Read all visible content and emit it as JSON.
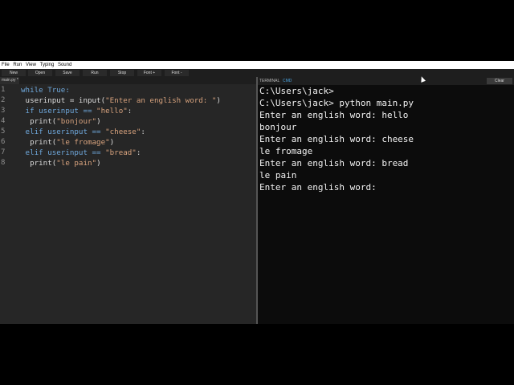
{
  "menu": {
    "items": [
      "File",
      "Run",
      "View",
      "Typing",
      "Sound"
    ]
  },
  "toolbar": {
    "buttons": [
      "New",
      "Open",
      "Save",
      "Run",
      "Stop",
      "Font +",
      "Font -"
    ]
  },
  "editor": {
    "tab_label": "main.py *",
    "line_numbers": [
      "1",
      "2",
      "3",
      "4",
      "5",
      "6",
      "7",
      "8"
    ],
    "lines": [
      [
        {
          "t": "while True:",
          "k": "kw"
        }
      ],
      [
        {
          "t": " userinput = input(",
          "k": ""
        },
        {
          "t": "\"Enter an english word: \"",
          "k": "str"
        },
        {
          "t": ")",
          "k": ""
        }
      ],
      [
        {
          "t": " if userinput == ",
          "k": "kw"
        },
        {
          "t": "\"hello\"",
          "k": "str"
        },
        {
          "t": ":",
          "k": ""
        }
      ],
      [
        {
          "t": "  print(",
          "k": ""
        },
        {
          "t": "\"bonjour\"",
          "k": "str"
        },
        {
          "t": ")",
          "k": ""
        }
      ],
      [
        {
          "t": " elif userinput == ",
          "k": "kw"
        },
        {
          "t": "\"cheese\"",
          "k": "str"
        },
        {
          "t": ":",
          "k": ""
        }
      ],
      [
        {
          "t": "  print(",
          "k": ""
        },
        {
          "t": "\"le fromage\"",
          "k": "str"
        },
        {
          "t": ")",
          "k": ""
        }
      ],
      [
        {
          "t": " elif userinput == ",
          "k": "kw"
        },
        {
          "t": "\"bread\"",
          "k": "str"
        },
        {
          "t": ":",
          "k": ""
        }
      ],
      [
        {
          "t": "  print(",
          "k": ""
        },
        {
          "t": "\"le pain\"",
          "k": "str"
        },
        {
          "t": ")",
          "k": ""
        }
      ]
    ]
  },
  "terminal": {
    "title": "TERMINAL",
    "shell": "CMD",
    "clear_label": "Clear",
    "lines": [
      "C:\\Users\\jack>",
      "C:\\Users\\jack> python main.py",
      "Enter an english word: hello",
      "bonjour",
      "Enter an english word: cheese",
      "le fromage",
      "Enter an english word: bread",
      "le pain",
      "Enter an english word:"
    ]
  },
  "colors": {
    "keyword": "#6fa8dc",
    "string": "#d7a27d",
    "shell_label": "#4aa3df"
  }
}
